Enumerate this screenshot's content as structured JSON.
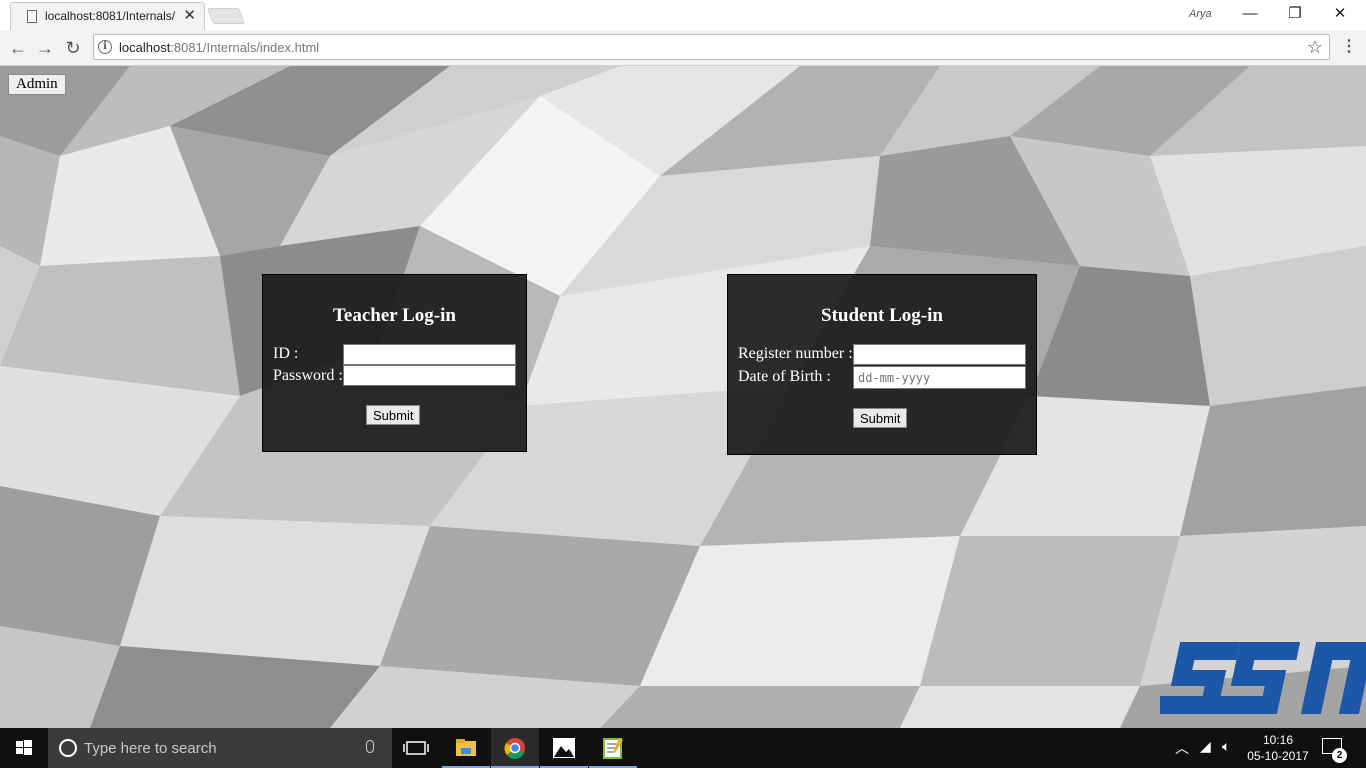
{
  "browser": {
    "tab_title": "localhost:8081/Internals/",
    "profile_name": "Arya",
    "url_host": "localhost",
    "url_path": ":8081/Internals/index.html"
  },
  "page": {
    "admin_button": "Admin",
    "teacher": {
      "title": "Teacher Log-in",
      "id_label": "ID :",
      "password_label": "Password :",
      "id_value": "",
      "password_value": "",
      "submit": "Submit"
    },
    "student": {
      "title": "Student Log-in",
      "register_label": "Register number :",
      "dob_label": "Date of Birth :",
      "register_value": "",
      "dob_placeholder": "dd-mm-yyyy",
      "submit": "Submit"
    },
    "logo": {
      "text": "SSN",
      "color": "#1d57a8"
    }
  },
  "taskbar": {
    "search_placeholder": "Type here to search",
    "time": "10:16",
    "date": "05-10-2017",
    "notification_count": "2",
    "apps": [
      "task-view-icon",
      "file-explorer-icon",
      "chrome-icon",
      "photos-icon",
      "notepad-icon"
    ]
  }
}
